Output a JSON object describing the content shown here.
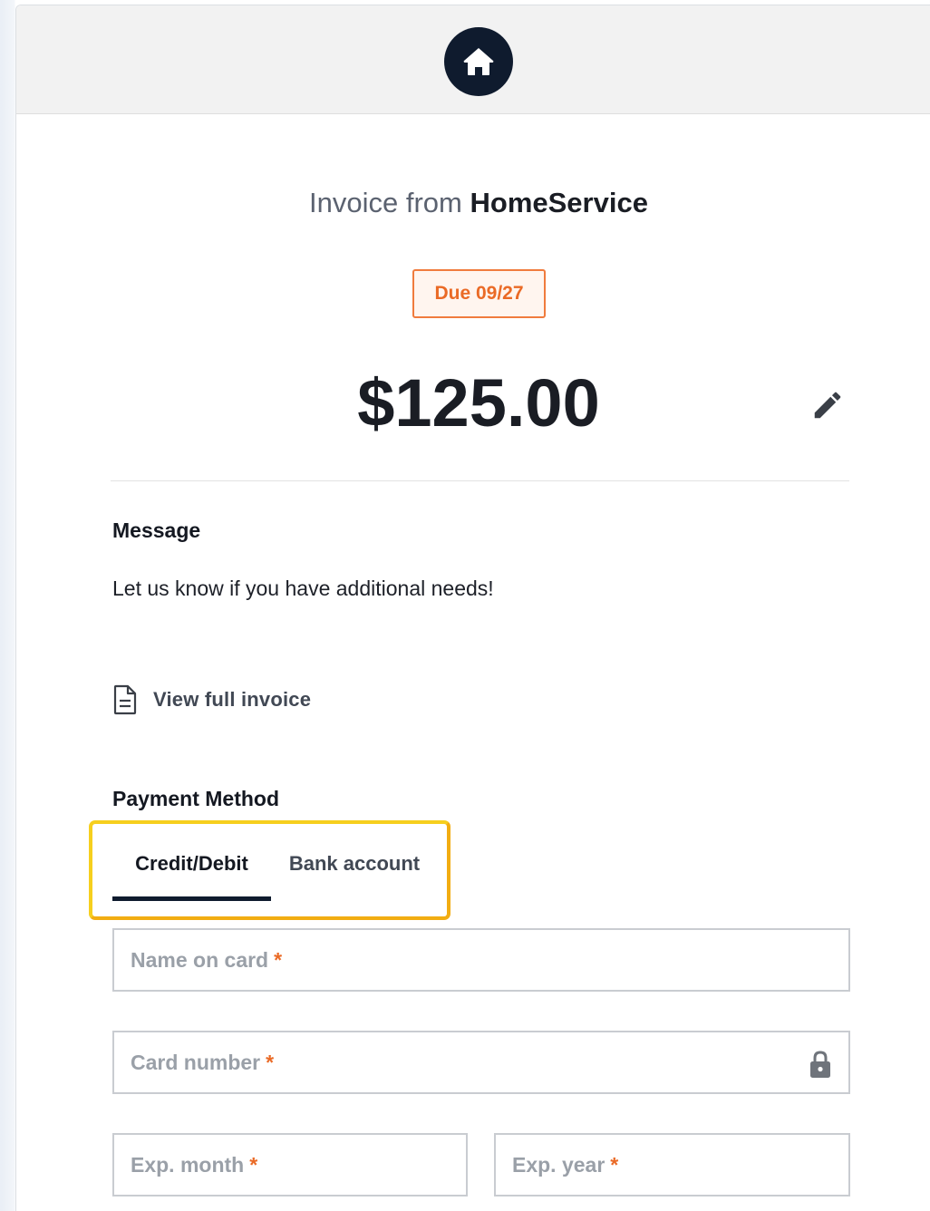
{
  "header": {
    "logo_icon": "home-icon"
  },
  "invoice": {
    "prefix": "Invoice from",
    "business": "HomeService",
    "due": "Due 09/27",
    "amount": "$125.00"
  },
  "message": {
    "title": "Message",
    "text": "Let us know if you have additional needs!"
  },
  "view_invoice": {
    "label": "View full invoice"
  },
  "payment": {
    "title": "Payment Method",
    "tabs": [
      {
        "label": "Credit/Debit",
        "active": true
      },
      {
        "label": "Bank account",
        "active": false
      }
    ],
    "fields": {
      "name_on_card": {
        "placeholder": "Name on card",
        "required_mark": "*",
        "value": ""
      },
      "card_number": {
        "placeholder": "Card number",
        "required_mark": "*",
        "value": ""
      },
      "exp_month": {
        "placeholder": "Exp. month",
        "required_mark": "*",
        "value": ""
      },
      "exp_year": {
        "placeholder": "Exp. year",
        "required_mark": "*",
        "value": ""
      }
    }
  },
  "colors": {
    "brand_dark": "#0f1b2e",
    "accent_orange": "#ea6a26",
    "highlight": "#f5c518"
  }
}
